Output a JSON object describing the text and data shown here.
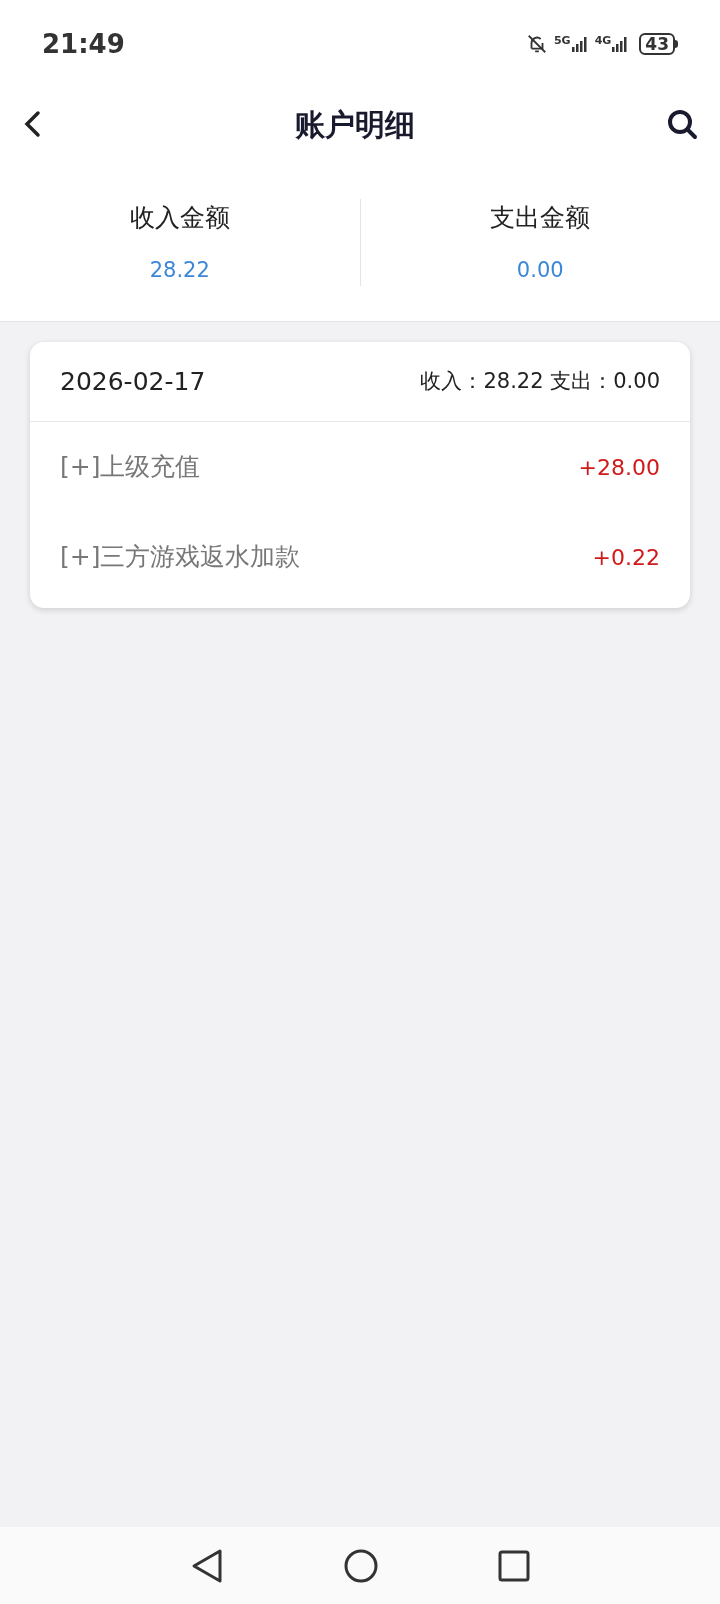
{
  "status_bar": {
    "time": "21:49",
    "networks": [
      "5G",
      "4G"
    ],
    "battery": "43"
  },
  "header": {
    "title": "账户明细"
  },
  "summary": [
    {
      "label": "收入金额",
      "value": "28.22"
    },
    {
      "label": "支出金额",
      "value": "0.00"
    }
  ],
  "days": [
    {
      "date": "2026-02-17",
      "totals": "收入：28.22 支出：0.00",
      "entries": [
        {
          "label": "[+]上级充值",
          "amount": "+28.00"
        },
        {
          "label": "[+]三方游戏返水加款",
          "amount": "+0.22"
        }
      ]
    }
  ]
}
